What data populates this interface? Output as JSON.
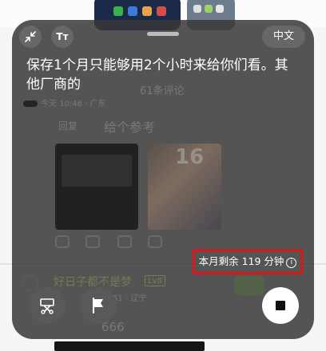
{
  "background": {
    "ghost_texts": {
      "comment_count": "61条评论",
      "meta_line": "今天 10:46 · 广东",
      "reply_text": "给个参考",
      "reply_prefix": "回复",
      "phone_number": "16",
      "username": "好日子都不是梦",
      "user_level": "Lv8",
      "reply_meta": "10:51 · 辽宁",
      "count_text": "666"
    }
  },
  "overlay": {
    "collapse_icon": "collapse-arrows-icon",
    "font_size_label": "Tт",
    "language_label": "中文",
    "caption": "保存1个月只能够用2个小时来给你们看。其他厂商的",
    "quota_text": "本月剩余 119 分钟",
    "info_glyph": "i",
    "buttons": [
      "scissors-icon",
      "flag-icon",
      "stop-icon"
    ]
  },
  "colors": {
    "panel_bg": "#373737",
    "highlight_border": "#e0141c",
    "text": "#ffffff"
  }
}
